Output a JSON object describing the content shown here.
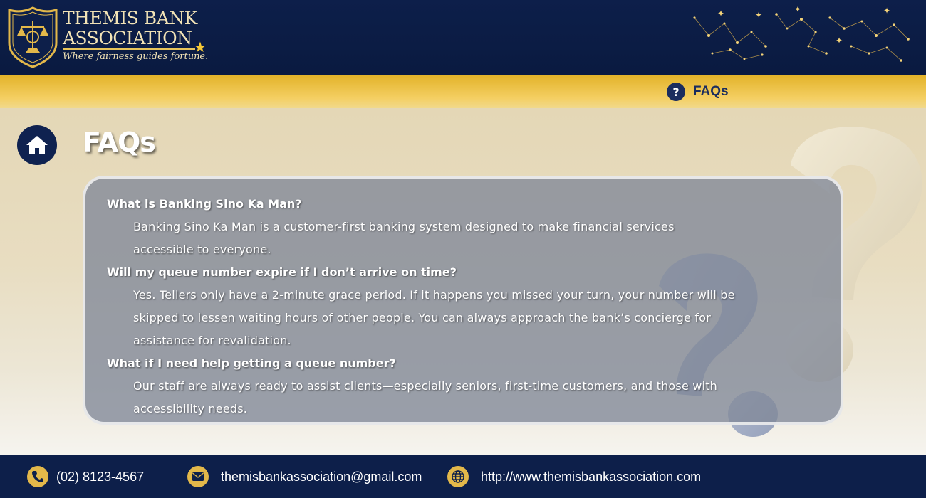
{
  "brand": {
    "name_line1": "THEMIS BANK",
    "name_line2": "ASSOCIATION",
    "tagline": "Where fairness guides fortune.",
    "logo_icon": "justice-scales-badge",
    "gold": "#e3b84a",
    "navy": "#0d1f4a"
  },
  "nav": {
    "items": [
      {
        "label": "FAQs",
        "icon": "question-circle-icon",
        "symbol": "?"
      }
    ]
  },
  "page": {
    "title": "FAQs",
    "home_icon": "home-icon"
  },
  "faqs": [
    {
      "question": "What is Banking Sino Ka Man?",
      "answer_lines": [
        "Banking Sino Ka Man is a customer-first banking system designed to make financial services",
        "accessible to everyone."
      ]
    },
    {
      "question": "Will my queue number expire if I don’t arrive on time?",
      "answer_lines": [
        "Yes. Tellers only have a 2-minute grace period. If it happens you missed your turn, your number will be",
        "skipped to lessen waiting hours of other people. You can always approach the bank’s concierge for",
        "assistance for revalidation."
      ]
    },
    {
      "question": "What if I need help getting a queue number?",
      "answer_lines": [
        "Our staff are always ready to assist clients—especially seniors, first-time customers, and those with",
        "accessibility needs."
      ]
    }
  ],
  "footer": {
    "phone": "(02) 8123-4567",
    "email": "themisbankassociation@gmail.com",
    "website": "http://www.themisbankassociation.com",
    "phone_icon": "phone-icon",
    "email_icon": "envelope-icon",
    "website_icon": "globe-icon"
  }
}
